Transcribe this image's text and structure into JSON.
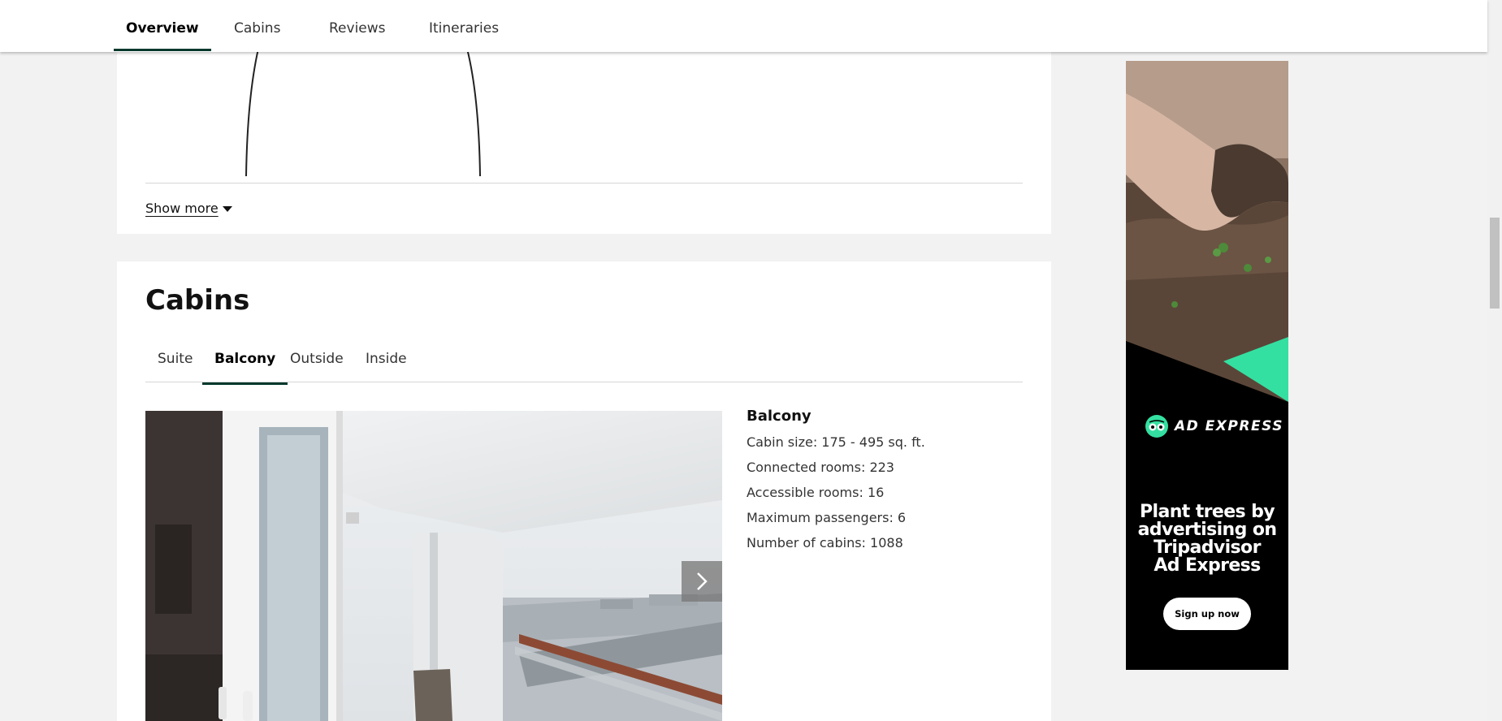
{
  "nav": {
    "tabs": [
      {
        "label": "Overview",
        "active": true
      },
      {
        "label": "Cabins",
        "active": false
      },
      {
        "label": "Reviews",
        "active": false
      },
      {
        "label": "Itineraries",
        "active": false
      }
    ]
  },
  "overview": {
    "show_more_label": "Show more"
  },
  "cabins": {
    "title": "Cabins",
    "tabs": [
      {
        "label": "Suite",
        "active": false
      },
      {
        "label": "Balcony",
        "active": true
      },
      {
        "label": "Outside",
        "active": false
      },
      {
        "label": "Inside",
        "active": false
      }
    ],
    "selected": {
      "name": "Balcony",
      "details": [
        "Cabin size: 175 - 495 sq. ft.",
        "Connected rooms: 223",
        "Accessible rooms: 16",
        "Maximum passengers: 6",
        "Number of cabins: 1088"
      ]
    }
  },
  "ad": {
    "brand": "AD EXPRESS",
    "headline_lines": [
      "Plant trees by",
      "advertising on",
      "Tripadvisor",
      "Ad Express"
    ],
    "cta_label": "Sign up now",
    "accent_color": "#34e0a1"
  },
  "colors": {
    "tab_underline": "#00382c",
    "page_background": "#f2f2f2"
  }
}
